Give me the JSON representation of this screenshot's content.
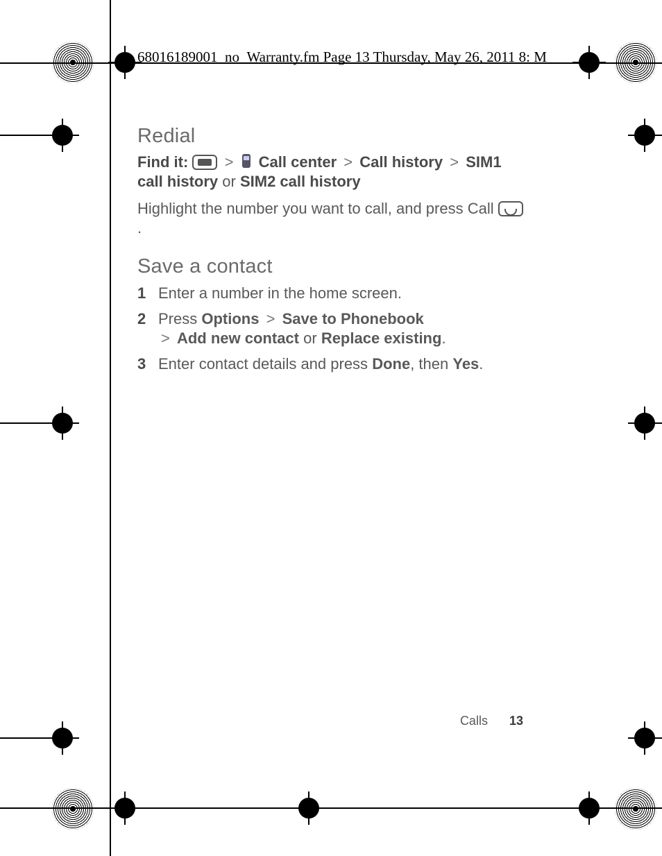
{
  "doc_header": "68016189001_no_Warranty.fm  Page 13  Thursday, May 26, 2011  8:      M",
  "sections": {
    "redial": {
      "title": "Redial",
      "find_it_label": "Find it:",
      "path": {
        "call_center": "Call center",
        "call_history": "Call history",
        "sim1": "SIM1 call history",
        "or": "or",
        "sim2": "SIM2 call history"
      },
      "instruction_pre": "Highlight the number you want to call, and press Call",
      "instruction_post": "."
    },
    "save_contact": {
      "title": "Save a contact",
      "steps": [
        {
          "text": "Enter a number in the home screen."
        },
        {
          "press": "Press",
          "options": "Options",
          "save_to": "Save to Phonebook",
          "add_new": "Add new contact",
          "or": "or",
          "replace": "Replace existing",
          "suffix": "."
        },
        {
          "pre": "Enter contact details and press",
          "done": "Done",
          "mid": ", then",
          "yes": "Yes",
          "suffix": "."
        }
      ]
    }
  },
  "footer": {
    "section": "Calls",
    "page": "13"
  }
}
